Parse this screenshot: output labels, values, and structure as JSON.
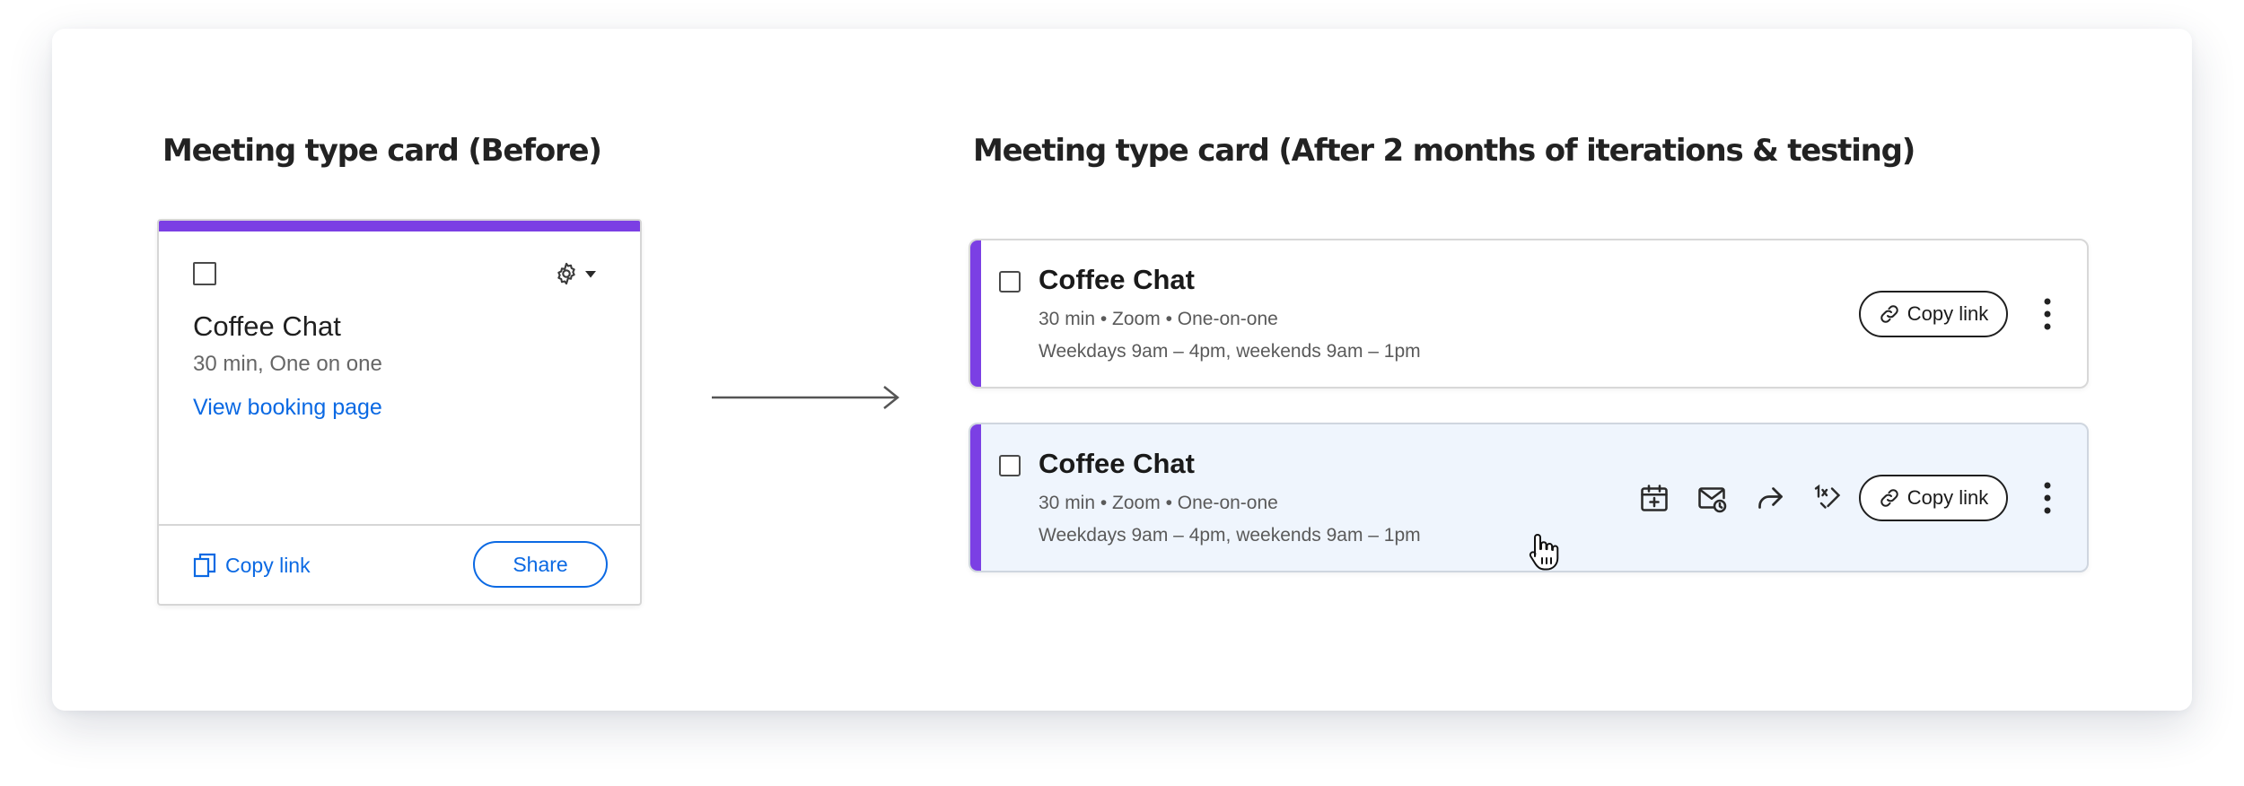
{
  "before": {
    "heading": "Meeting type card (Before)",
    "card": {
      "title": "Coffee Chat",
      "subtitle": "30 min, One on one",
      "booking_link": "View booking page",
      "copy_link": "Copy link",
      "share": "Share",
      "accent_color": "#7b3fe4",
      "icons": [
        "checkbox",
        "gear-icon",
        "caret-down-icon",
        "copy-icon"
      ]
    }
  },
  "after": {
    "heading": "Meeting type card (After 2 months of iterations & testing)",
    "cards": [
      {
        "state": "default",
        "title": "Coffee Chat",
        "meta": "30 min • Zoom • One-on-one",
        "hours": "Weekdays 9am – 4pm, weekends 9am – 1pm",
        "copy_link": "Copy link"
      },
      {
        "state": "hover",
        "title": "Coffee Chat",
        "meta": "30 min • Zoom • One-on-one",
        "hours": "Weekdays 9am – 4pm, weekends 9am – 1pm",
        "copy_link": "Copy link",
        "hover_icons": [
          "calendar-add-icon",
          "mail-clock-icon",
          "share-arrow-icon",
          "one-time-link-icon"
        ]
      }
    ],
    "accent_color": "#7b3fe4",
    "hover_background": "#eff5fd"
  },
  "colors": {
    "link_blue": "#0b69e3",
    "text_dark": "#1a1a1a",
    "text_muted": "#5a5a5a"
  }
}
